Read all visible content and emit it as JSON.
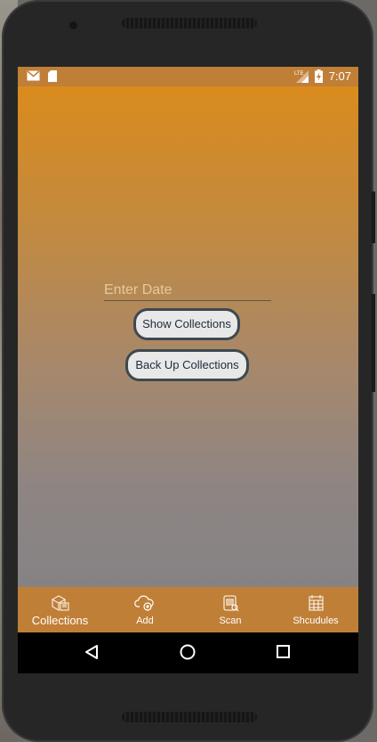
{
  "status_bar": {
    "time": "7:07",
    "icons": [
      "gmail-icon",
      "sd-card-icon",
      "lte-signal-icon",
      "battery-charging-icon"
    ]
  },
  "form": {
    "date_placeholder": "Enter Date",
    "show_collections_label": "Show Collections",
    "back_up_collections_label": "Back Up Collections"
  },
  "bottom_nav": {
    "items": [
      {
        "label": "Collections",
        "icon": "boxes-icon"
      },
      {
        "label": "Add",
        "icon": "cloud-add-icon"
      },
      {
        "label": "Scan",
        "icon": "scan-document-icon"
      },
      {
        "label": "Shcudules",
        "icon": "schedule-sheet-icon"
      }
    ]
  },
  "system_nav": {
    "icons": [
      "back-icon",
      "home-icon",
      "recents-icon"
    ]
  },
  "colors": {
    "accent": "#c07f37",
    "gradient_top": "#da8b1d",
    "gradient_bottom": "#868284",
    "button_border": "#3d4950"
  }
}
